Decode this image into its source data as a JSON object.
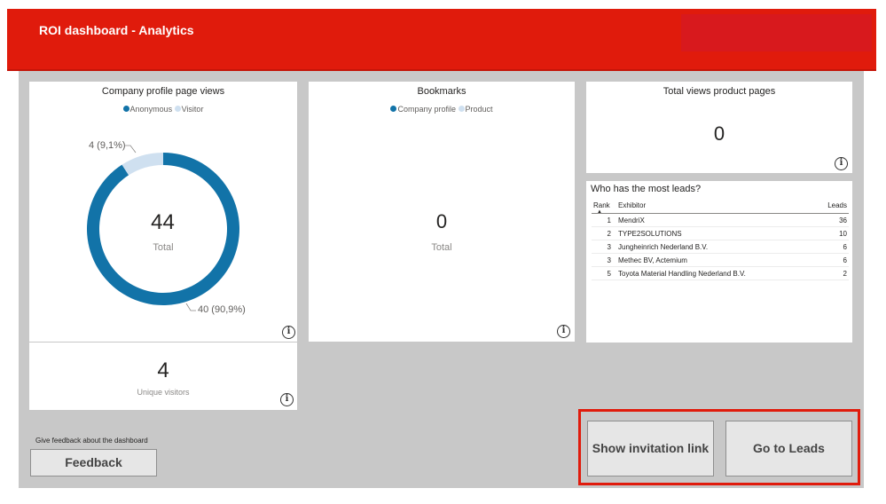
{
  "header": {
    "title": "ROI dashboard - Analytics"
  },
  "profile_views": {
    "title": "Company profile page views",
    "legend": [
      {
        "label": "Anonymous",
        "color": "#1273a8"
      },
      {
        "label": "Visitor",
        "color": "#cfe0f0"
      }
    ],
    "total": "44",
    "total_label": "Total",
    "slice_labels": {
      "visitor": "4 (9,1%)",
      "anonymous": "40 (90,9%)"
    }
  },
  "chart_data": {
    "type": "pie",
    "title": "Company profile page views",
    "categories": [
      "Anonymous",
      "Visitor"
    ],
    "values": [
      40,
      4
    ],
    "colors": [
      "#1273a8",
      "#cfe0f0"
    ],
    "legend_position": "top"
  },
  "unique_visitors": {
    "value": "4",
    "label": "Unique visitors"
  },
  "bookmarks": {
    "title": "Bookmarks",
    "legend": [
      {
        "label": "Company profile",
        "color": "#1273a8"
      },
      {
        "label": "Product",
        "color": "#cfe0f0"
      }
    ],
    "total": "0",
    "total_label": "Total"
  },
  "product_views": {
    "title": "Total views product pages",
    "value": "0"
  },
  "leads": {
    "title": "Who has the most leads?",
    "columns": {
      "rank": "Rank",
      "exhibitor": "Exhibitor",
      "leads": "Leads"
    },
    "rows": [
      {
        "rank": "1",
        "exhibitor": "MendriX",
        "leads": "36"
      },
      {
        "rank": "2",
        "exhibitor": "TYPE2SOLUTIONS",
        "leads": "10"
      },
      {
        "rank": "3",
        "exhibitor": "Jungheinrich Nederland B.V.",
        "leads": "6"
      },
      {
        "rank": "3",
        "exhibitor": "Methec BV, Actemium",
        "leads": "6"
      },
      {
        "rank": "5",
        "exhibitor": "Toyota Material Handling Nederland B.V.",
        "leads": "2"
      }
    ]
  },
  "feedback": {
    "label": "Give feedback about the dashboard",
    "button": "Feedback"
  },
  "actions": {
    "invitation_button": "Show invitation link",
    "leads_button": "Go to Leads"
  },
  "info_icon_glyph": "i"
}
